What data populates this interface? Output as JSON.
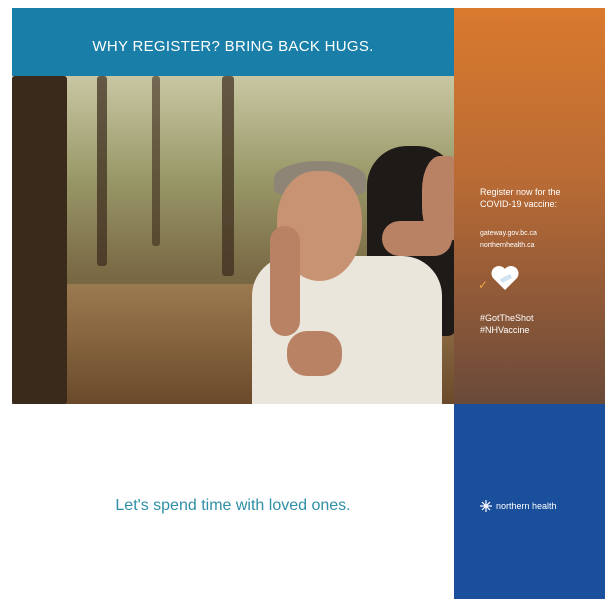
{
  "banner": {
    "headline": "WHY REGISTER? BRING BACK HUGS."
  },
  "side_panel": {
    "cta": "Register now for the COVID-19 vaccine:",
    "url_line1": "gateway.gov.bc.ca",
    "url_line2": "northernhealth.ca",
    "hashtag1": "#GotTheShot",
    "hashtag2": "#NHVaccine"
  },
  "footer": {
    "tagline": "Let's spend time with loved ones.",
    "logo_text": "northern health"
  },
  "colors": {
    "banner_blue": "#1a7fa8",
    "side_orange": "#d97a2e",
    "footer_blue": "#1a4f9c",
    "tagline_teal": "#2f8fa6"
  }
}
